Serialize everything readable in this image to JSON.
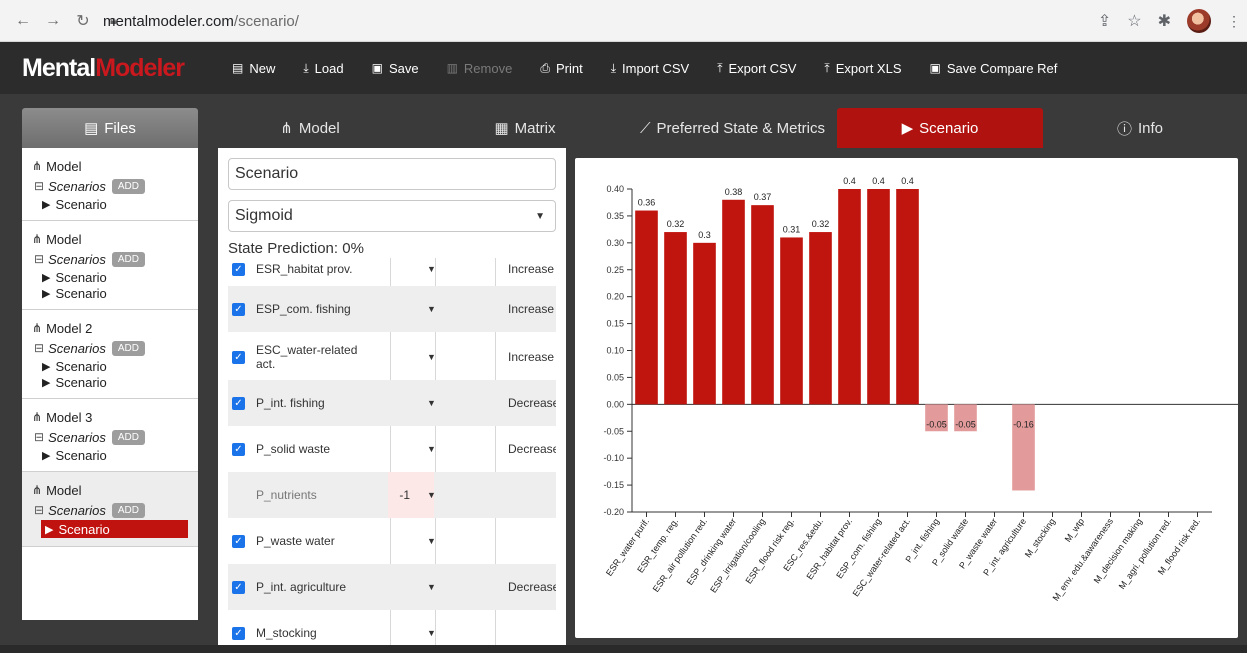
{
  "browser": {
    "url_host": "mentalmodeler.com",
    "url_path": "/scenario/"
  },
  "app": {
    "logo_part1": "Mental",
    "logo_part2": "Modeler",
    "toolbar": [
      {
        "label": "New",
        "icon": "file-icon",
        "enabled": true
      },
      {
        "label": "Load",
        "icon": "download-icon",
        "enabled": true
      },
      {
        "label": "Save",
        "icon": "floppy-icon",
        "enabled": true
      },
      {
        "label": "Remove",
        "icon": "trash-icon",
        "enabled": false
      },
      {
        "label": "Print",
        "icon": "print-icon",
        "enabled": true
      },
      {
        "label": "Import CSV",
        "icon": "download-icon",
        "enabled": true
      },
      {
        "label": "Export CSV",
        "icon": "upload-icon",
        "enabled": true
      },
      {
        "label": "Export XLS",
        "icon": "upload-icon",
        "enabled": true
      },
      {
        "label": "Save Compare Ref",
        "icon": "floppy-icon",
        "enabled": true
      }
    ],
    "tabs": {
      "files": "Files",
      "model": "Model",
      "matrix": "Matrix",
      "preferred": "Preferred State & Metrics",
      "scenario": "Scenario",
      "info": "Info"
    },
    "accent_color": "#b0120f"
  },
  "sidebar": {
    "scenarios_label": "Scenarios",
    "add_label": "ADD",
    "groups": [
      {
        "model": "Model",
        "scenarios": [
          "Scenario"
        ]
      },
      {
        "model": "Model",
        "scenarios": [
          "Scenario",
          "Scenario"
        ]
      },
      {
        "model": "Model 2",
        "scenarios": [
          "Scenario",
          "Scenario"
        ]
      },
      {
        "model": "Model 3",
        "scenarios": [
          "Scenario"
        ]
      },
      {
        "model": "Model",
        "scenarios": [
          "Scenario"
        ],
        "active": true
      }
    ]
  },
  "scenario": {
    "name": "Scenario",
    "function": "Sigmoid",
    "state_prediction": "State Prediction: 0%",
    "rows": [
      {
        "label": "ESR_habitat prov.",
        "checked": true,
        "value": "",
        "direction": "Increase"
      },
      {
        "label": "ESP_com. fishing",
        "checked": true,
        "value": "",
        "direction": "Increase"
      },
      {
        "label": "ESC_water-related act.",
        "checked": true,
        "value": "",
        "direction": "Increase"
      },
      {
        "label": "P_int. fishing",
        "checked": true,
        "value": "",
        "direction": "Decrease"
      },
      {
        "label": "P_solid waste",
        "checked": true,
        "value": "",
        "direction": "Decrease"
      },
      {
        "label": "P_nutrients",
        "checked": false,
        "value": "-1",
        "direction": ""
      },
      {
        "label": "P_waste water",
        "checked": true,
        "value": "",
        "direction": ""
      },
      {
        "label": "P_int. agriculture",
        "checked": true,
        "value": "",
        "direction": "Decrease"
      },
      {
        "label": "M_stocking",
        "checked": true,
        "value": "",
        "direction": ""
      }
    ]
  },
  "chart_data": {
    "type": "bar",
    "categories": [
      "ESR_water purif.",
      "ESR_temp. reg.",
      "ESR_air pollution red.",
      "ESP_drinking water",
      "ESP_irrigation/cooling",
      "ESR_flood risk reg.",
      "ESC_res.&edu.",
      "ESR_habitat prov.",
      "ESP_com. fishing",
      "ESC_water-related act.",
      "P_int. fishing",
      "P_solid waste",
      "P_waste water",
      "P_int. agriculture",
      "M_stocking",
      "M_wtp",
      "M_env. edu.&awareness",
      "M_decision making",
      "M_agri. pollution red.",
      "M_flood risk red."
    ],
    "values": [
      0.36,
      0.32,
      0.3,
      0.38,
      0.37,
      0.31,
      0.32,
      0.4,
      0.4,
      0.4,
      -0.05,
      -0.05,
      0,
      -0.16,
      0,
      0,
      0,
      0,
      0,
      0
    ],
    "labels": [
      "0.36",
      "0.32",
      "0.3",
      "0.38",
      "0.37",
      "0.31",
      "0.32",
      "0.4",
      "0.4",
      "0.4",
      "-0.05",
      "-0.05",
      "",
      "-0.16",
      "",
      "",
      "",
      "",
      "",
      ""
    ],
    "yticks": [
      "0.40",
      "0.35",
      "0.30",
      "0.25",
      "0.20",
      "0.15",
      "0.10",
      "0.05",
      "0.00",
      "-0.05",
      "-0.10",
      "-0.15",
      "-0.20"
    ],
    "ylim": [
      -0.2,
      0.4
    ],
    "positive_color": "#c0140f",
    "negative_color": "#e39a9a",
    "grid": false
  }
}
